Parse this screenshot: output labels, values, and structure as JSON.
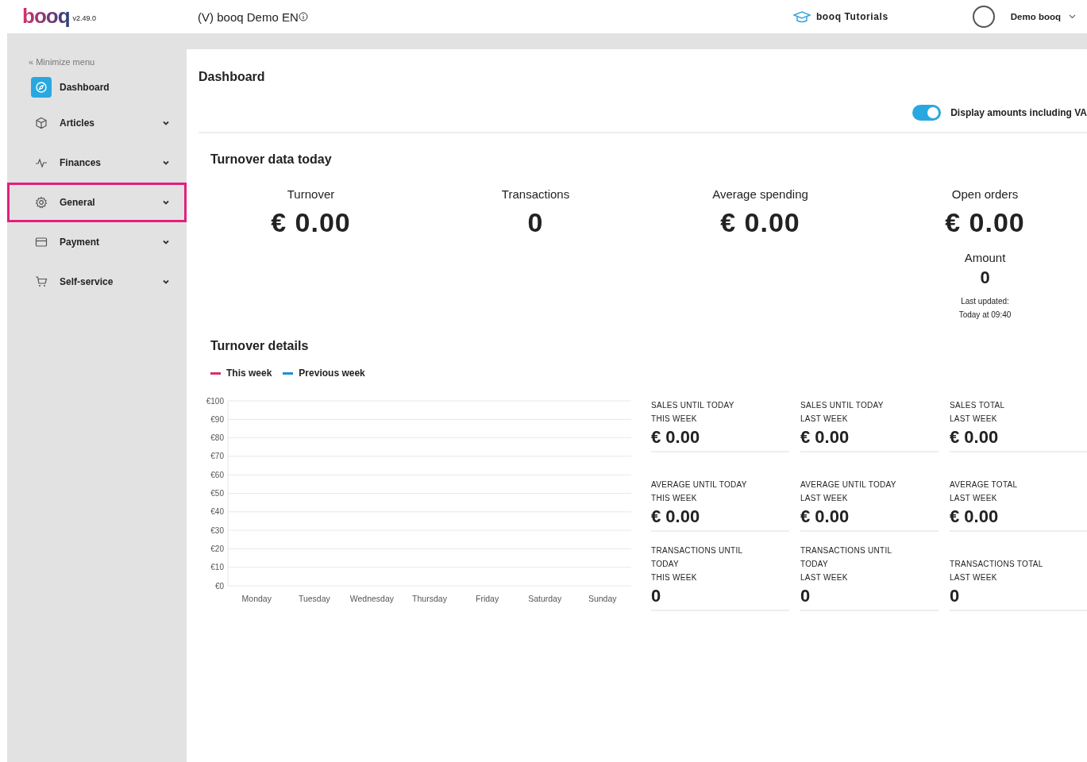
{
  "header": {
    "logo": "booq",
    "version": "v2.49.0",
    "venue": "(V) booq Demo EN",
    "tutorials": "booq Tutorials",
    "user": "Demo booq"
  },
  "sidebar": {
    "minimize": "« Minimize menu",
    "items": [
      {
        "label": "Dashboard",
        "selected": true,
        "expandable": false,
        "highlighted": false
      },
      {
        "label": "Articles",
        "selected": false,
        "expandable": true,
        "highlighted": false
      },
      {
        "label": "Finances",
        "selected": false,
        "expandable": true,
        "highlighted": false
      },
      {
        "label": "General",
        "selected": false,
        "expandable": true,
        "highlighted": true
      },
      {
        "label": "Payment",
        "selected": false,
        "expandable": true,
        "highlighted": false
      },
      {
        "label": "Self-service",
        "selected": false,
        "expandable": true,
        "highlighted": false
      }
    ]
  },
  "page_title": "Dashboard",
  "vat_toggle": {
    "label": "Display amounts including VA",
    "on": true
  },
  "today": {
    "title": "Turnover data today",
    "metrics": [
      {
        "label": "Turnover",
        "value": "€ 0.00"
      },
      {
        "label": "Transactions",
        "value": "0"
      },
      {
        "label": "Average spending",
        "value": "€ 0.00"
      },
      {
        "label": "Open orders",
        "value": "€ 0.00",
        "sub_label": "Amount",
        "sub_value": "0",
        "note": [
          "Last updated:",
          "Today at 09:40"
        ]
      }
    ]
  },
  "details": {
    "title": "Turnover details",
    "chart_data": {
      "type": "line",
      "categories": [
        "Monday",
        "Tuesday",
        "Wednesday",
        "Thursday",
        "Friday",
        "Saturday",
        "Sunday"
      ],
      "ylim": [
        0,
        100
      ],
      "grid": true,
      "yticks": [
        {
          "value": 0,
          "label": "€0"
        },
        {
          "value": 10,
          "label": "€10"
        },
        {
          "value": 20,
          "label": "€20"
        },
        {
          "value": 30,
          "label": "€30"
        },
        {
          "value": 40,
          "label": "€40"
        },
        {
          "value": 50,
          "label": "€50"
        },
        {
          "value": 60,
          "label": "€60"
        },
        {
          "value": 70,
          "label": "€70"
        },
        {
          "value": 80,
          "label": "€80"
        },
        {
          "value": 90,
          "label": "€90"
        },
        {
          "value": 100,
          "label": "€100"
        }
      ],
      "series": [
        {
          "name": "This week",
          "color": "#d6336c",
          "values": [
            null,
            null,
            null,
            null,
            null,
            null,
            null
          ]
        },
        {
          "name": "Previous week",
          "color": "#1e8fd6",
          "values": [
            null,
            null,
            null,
            null,
            null,
            null,
            null
          ]
        }
      ]
    },
    "stats": [
      {
        "label": [
          "SALES UNTIL TODAY",
          "THIS WEEK"
        ],
        "value": "€ 0.00"
      },
      {
        "label": [
          "SALES UNTIL TODAY",
          "LAST WEEK"
        ],
        "value": "€ 0.00"
      },
      {
        "label": [
          "SALES TOTAL",
          "LAST WEEK"
        ],
        "value": "€ 0.00"
      },
      {
        "label": [
          "AVERAGE UNTIL TODAY",
          "THIS WEEK"
        ],
        "value": "€ 0.00"
      },
      {
        "label": [
          "AVERAGE UNTIL TODAY",
          "LAST WEEK"
        ],
        "value": "€ 0.00"
      },
      {
        "label": [
          "AVERAGE TOTAL",
          "LAST WEEK"
        ],
        "value": "€ 0.00"
      },
      {
        "label": [
          "TRANSACTIONS UNTIL",
          "TODAY",
          "THIS WEEK"
        ],
        "value": "0"
      },
      {
        "label": [
          "TRANSACTIONS UNTIL",
          "TODAY",
          "LAST WEEK"
        ],
        "value": "0"
      },
      {
        "label": [
          "TRANSACTIONS TOTAL",
          "LAST WEEK"
        ],
        "value": "0"
      }
    ]
  }
}
